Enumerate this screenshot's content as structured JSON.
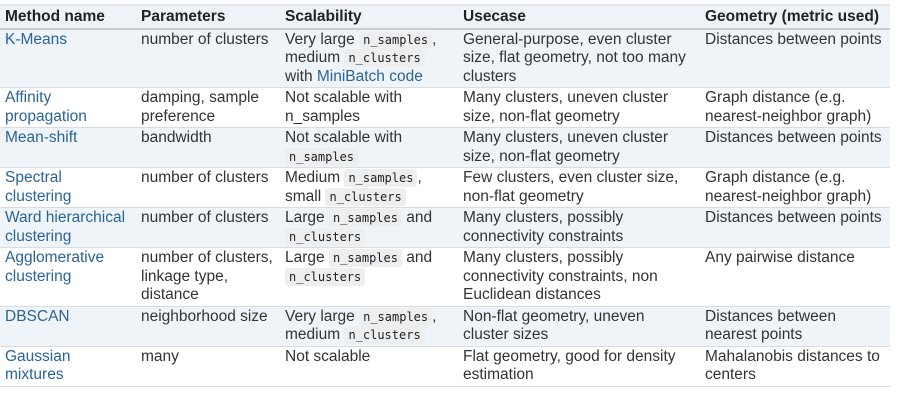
{
  "headers": [
    "Method name",
    "Parameters",
    "Scalability",
    "Usecase",
    "Geometry (metric used)"
  ],
  "rows": [
    {
      "method": "K-Means",
      "params": "number of clusters",
      "scal": [
        {
          "t": "Very large "
        },
        {
          "t": "n_samples",
          "code": true
        },
        {
          "t": ", medium "
        },
        {
          "t": "n_clusters",
          "code": true
        },
        {
          "t": " with "
        },
        {
          "t": "MiniBatch code",
          "link": true
        }
      ],
      "use": "General-purpose, even cluster size, flat geometry, not too many clusters",
      "geom": "Distances between points"
    },
    {
      "method": "Affinity propagation",
      "params": "damping, sample preference",
      "scal": [
        {
          "t": "Not scalable with n_samples"
        }
      ],
      "use": "Many clusters, uneven cluster size, non-flat geometry",
      "geom": "Graph distance (e.g. nearest-neighbor graph)"
    },
    {
      "method": "Mean-shift",
      "params": "bandwidth",
      "scal": [
        {
          "t": "Not scalable with "
        },
        {
          "t": "n_samples",
          "code": true
        }
      ],
      "use": "Many clusters, uneven cluster size, non-flat geometry",
      "geom": "Distances between points"
    },
    {
      "method": "Spectral clustering",
      "params": "number of clusters",
      "scal": [
        {
          "t": "Medium "
        },
        {
          "t": "n_samples",
          "code": true
        },
        {
          "t": ", small "
        },
        {
          "t": "n_clusters",
          "code": true
        }
      ],
      "use": "Few clusters, even cluster size, non-flat geometry",
      "geom": "Graph distance (e.g. nearest-neighbor graph)"
    },
    {
      "method": "Ward hierarchical clustering",
      "params": "number of clusters",
      "scal": [
        {
          "t": "Large "
        },
        {
          "t": "n_samples",
          "code": true
        },
        {
          "t": " and "
        },
        {
          "t": "n_clusters",
          "code": true
        }
      ],
      "use": "Many clusters, possibly connectivity constraints",
      "geom": "Distances between points"
    },
    {
      "method": "Agglomerative clustering",
      "params": "number of clusters, linkage type, distance",
      "scal": [
        {
          "t": "Large "
        },
        {
          "t": "n_samples",
          "code": true
        },
        {
          "t": " and "
        },
        {
          "t": "n_clusters",
          "code": true
        }
      ],
      "use": "Many clusters, possibly connectivity constraints, non Euclidean distances",
      "geom": "Any pairwise distance"
    },
    {
      "method": "DBSCAN",
      "params": "neighborhood size",
      "scal": [
        {
          "t": "Very large "
        },
        {
          "t": "n_samples",
          "code": true
        },
        {
          "t": ", medium "
        },
        {
          "t": "n_clusters",
          "code": true
        }
      ],
      "use": "Non-flat geometry, uneven cluster sizes",
      "geom": "Distances between nearest points"
    },
    {
      "method": "Gaussian mixtures",
      "params": "many",
      "scal": [
        {
          "t": "Not scalable"
        }
      ],
      "use": "Flat geometry, good for density estimation",
      "geom": "Mahalanobis distances to centers"
    }
  ]
}
